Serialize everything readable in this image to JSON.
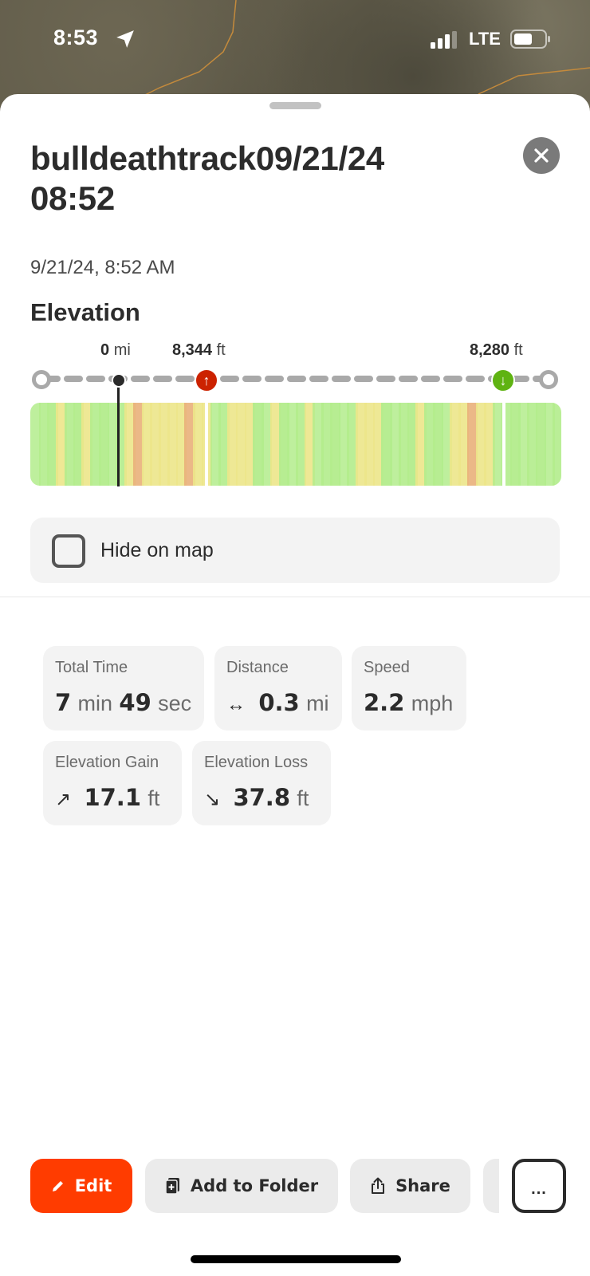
{
  "status_bar": {
    "time": "8:53",
    "network": "LTE",
    "signal_bars": 3,
    "signal_bars_total": 4,
    "battery_percent": 60
  },
  "track": {
    "title": "bulldeathtrack09/21/24 08:52",
    "date": "9/21/24, 8:52 AM",
    "close_icon": "close-icon"
  },
  "elevation": {
    "heading": "Elevation",
    "cursor_value": "0",
    "cursor_unit": "mi",
    "high_value": "8,344",
    "high_unit": "ft",
    "low_value": "8,280",
    "low_unit": "ft",
    "high_marker_icon": "arrow-up-icon",
    "low_marker_icon": "arrow-down-icon",
    "colors": {
      "high_marker": "#cc2200",
      "low_marker": "#5fb312",
      "gradient_green": "#b3ec8c",
      "gradient_yellow": "#ece68a",
      "gradient_orange": "#e9b07a"
    }
  },
  "hide_on_map": {
    "label": "Hide on map",
    "checked": false
  },
  "stats": {
    "total_time": {
      "label": "Total Time",
      "min_value": "7",
      "min_unit": "min",
      "sec_value": "49",
      "sec_unit": "sec"
    },
    "distance": {
      "label": "Distance",
      "icon": "↔",
      "value": "0.3",
      "unit": "mi"
    },
    "speed": {
      "label": "Speed",
      "value": "2.2",
      "unit": "mph"
    },
    "elevation_gain": {
      "label": "Elevation Gain",
      "icon": "↗",
      "value": "17.1",
      "unit": "ft"
    },
    "elevation_loss": {
      "label": "Elevation Loss",
      "icon": "↘",
      "value": "37.8",
      "unit": "ft"
    }
  },
  "actions": {
    "edit_label": "Edit",
    "add_to_folder_label": "Add to Folder",
    "share_label": "Share",
    "more_label": "...",
    "accent_color": "#ff3c00"
  }
}
